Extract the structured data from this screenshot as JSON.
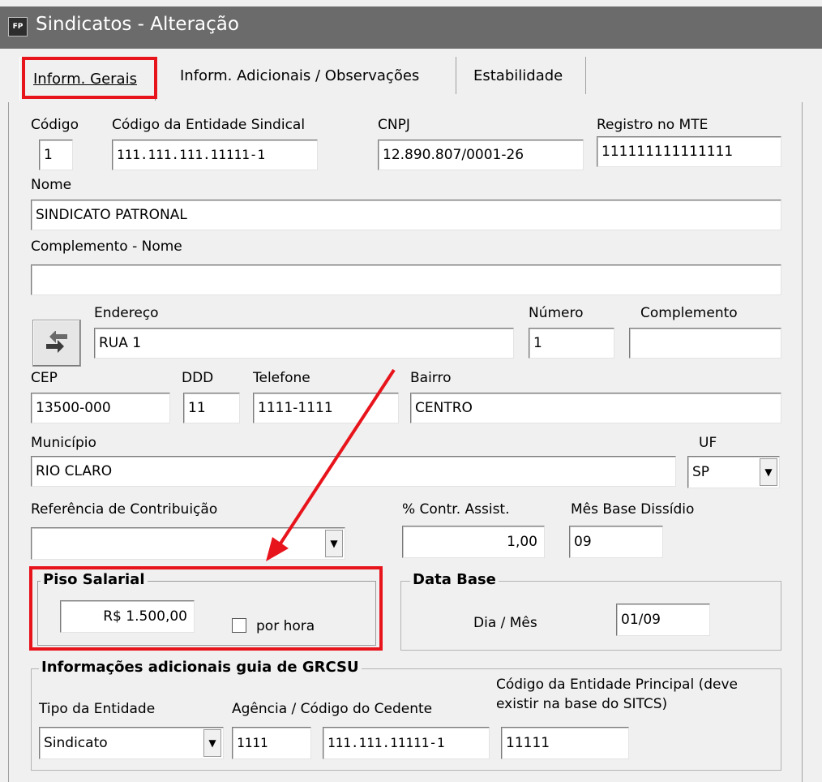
{
  "window": {
    "title": "Sindicatos - Alteração",
    "icon_text": "FP"
  },
  "tabs": [
    {
      "label": "Inform. Gerais"
    },
    {
      "label": "Inform. Adicionais / Observações"
    },
    {
      "label": "Estabilidade"
    }
  ],
  "fields": {
    "codigo": {
      "label": "Código",
      "value": "1"
    },
    "codigo_entidade": {
      "label": "Código da Entidade Sindical",
      "value": "111.111.111.11111-1"
    },
    "cnpj": {
      "label": "CNPJ",
      "value": "12.890.807/0001-26"
    },
    "registro_mte": {
      "label": "Registro no MTE",
      "value": "111111111111111"
    },
    "nome": {
      "label": "Nome",
      "value": "SINDICATO PATRONAL"
    },
    "complemento_nome": {
      "label": "Complemento - Nome",
      "value": ""
    },
    "endereco": {
      "label": "Endereço",
      "value": "RUA 1"
    },
    "numero": {
      "label": "Número",
      "value": "1"
    },
    "complemento": {
      "label": "Complemento",
      "value": ""
    },
    "cep": {
      "label": "CEP",
      "value": "13500-000"
    },
    "ddd": {
      "label": "DDD",
      "value": "11"
    },
    "telefone": {
      "label": "Telefone",
      "value": "1111-1111"
    },
    "bairro": {
      "label": "Bairro",
      "value": "CENTRO"
    },
    "municipio": {
      "label": "Município",
      "value": "RIO CLARO"
    },
    "uf": {
      "label": "UF",
      "value": "SP"
    },
    "referencia": {
      "label": "Referência de Contribuição",
      "value": ""
    },
    "contr_assist": {
      "label": "% Contr. Assist.",
      "value": "1,00"
    },
    "mes_base": {
      "label": "Mês Base Dissídio",
      "value": "09"
    }
  },
  "piso": {
    "title": "Piso Salarial",
    "value": "R$ 1.500,00",
    "por_hora_label": "por hora",
    "por_hora_checked": false
  },
  "data_base": {
    "title": "Data Base",
    "label": "Dia / Mês",
    "value": "01/09"
  },
  "grcsu": {
    "title": "Informações adicionais guia de GRCSU",
    "tipo_label": "Tipo da Entidade",
    "tipo_value": "Sindicato",
    "agencia_label": "Agência / Código do Cedente",
    "agencia_value": "1111",
    "cedente_value": "111.111.11111-1",
    "principal_label_1": "Código da Entidade Principal (deve",
    "principal_label_2": "existir na base do SITCS)",
    "principal_value": "11111"
  },
  "colors": {
    "highlight": "#e8141c",
    "titlebar": "#6b6b6b",
    "window_bg": "#f0f0f0"
  },
  "icons": [
    "swap-arrows-icon",
    "chevron-down-icon",
    "app-icon"
  ]
}
